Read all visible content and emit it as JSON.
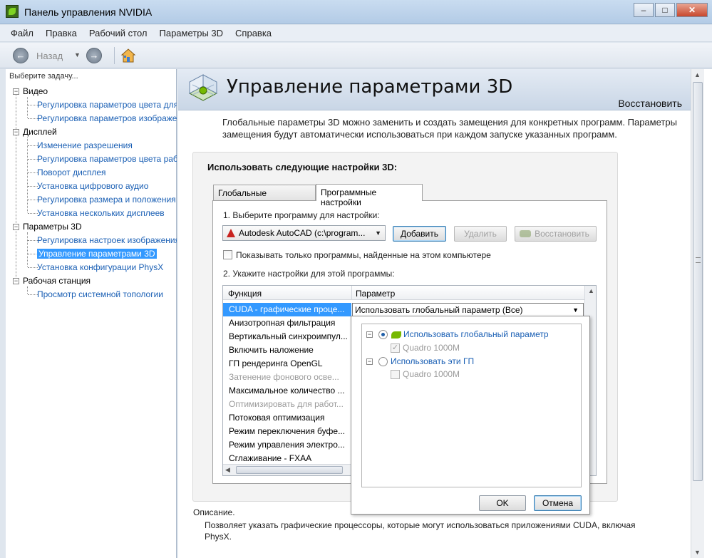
{
  "window": {
    "title": "Панель управления NVIDIA"
  },
  "menu": [
    "Файл",
    "Правка",
    "Рабочий стол",
    "Параметры 3D",
    "Справка"
  ],
  "toolbar": {
    "back_label": "Назад"
  },
  "sidebar": {
    "heading": "Выберите задачу...",
    "groups": [
      {
        "label": "Видео",
        "items": [
          "Регулировка параметров цвета для видео",
          "Регулировка параметров изображения для видео"
        ]
      },
      {
        "label": "Дисплей",
        "items": [
          "Изменение разрешения",
          "Регулировка параметров цвета рабочего стола",
          "Поворот дисплея",
          "Установка цифрового аудио",
          "Регулировка размера и положения рабочего стола",
          "Установка нескольких дисплеев"
        ]
      },
      {
        "label": "Параметры 3D",
        "items": [
          "Регулировка настроек изображения с просмотром",
          "Управление параметрами 3D",
          "Установка конфигурации PhysX"
        ]
      },
      {
        "label": "Рабочая станция",
        "items": [
          "Просмотр системной топологии"
        ]
      }
    ],
    "selected": "Управление параметрами 3D"
  },
  "page": {
    "title": "Управление параметрами 3D",
    "restore": "Восстановить",
    "intro": "Глобальные параметры 3D можно заменить и создать замещения для конкретных программ. Параметры замещения будут автоматически использоваться при каждом запуске указанных программ.",
    "settings_title": "Использовать следующие настройки 3D:",
    "tabs": [
      "Глобальные параметры",
      "Программные настройки"
    ],
    "active_tab": "Программные настройки",
    "step1": "1. Выберите программу для настройки:",
    "program_select": "Autodesk AutoCAD (c:\\program...",
    "add_button": "Добавить",
    "remove_button": "Удалить",
    "restore_button": "Восстановить",
    "show_only_checkbox": "Показывать только программы, найденные на этом компьютере",
    "step2": "2. Укажите настройки для этой программы:",
    "grid_headers": [
      "Функция",
      "Параметр"
    ],
    "grid_rows": [
      {
        "label": "CUDA - графические проце...",
        "state": "selected"
      },
      {
        "label": "Анизотропная фильтрация",
        "state": "normal"
      },
      {
        "label": "Вертикальный синхроимпул...",
        "state": "normal"
      },
      {
        "label": "Включить наложение",
        "state": "normal"
      },
      {
        "label": "ГП рендеринга OpenGL",
        "state": "normal"
      },
      {
        "label": "Затенение фонового осве...",
        "state": "disabled"
      },
      {
        "label": "Максимальное количество ...",
        "state": "normal"
      },
      {
        "label": "Оптимизировать для работ...",
        "state": "disabled"
      },
      {
        "label": "Потоковая оптимизация",
        "state": "normal"
      },
      {
        "label": "Режим переключения буфе...",
        "state": "normal"
      },
      {
        "label": "Режим управления электро...",
        "state": "normal"
      },
      {
        "label": "Сглаживание - FXAA",
        "state": "normal"
      }
    ],
    "param_value": "Использовать глобальный параметр (Все)",
    "dropdown": {
      "option_global": "Использовать глобальный параметр",
      "gpu_global": "Quadro 1000M",
      "option_these": "Использовать эти ГП",
      "gpu_these": "Quadro 1000M",
      "ok": "OK",
      "cancel": "Отмена"
    },
    "description_label": "Описание.",
    "description_text": "Позволяет указать графические процессоры, которые могут использоваться приложениями CUDA, включая PhysX."
  },
  "colors": {
    "selection": "#3399ff",
    "link": "#1a5fb4",
    "nvidia_green": "#76b900"
  }
}
